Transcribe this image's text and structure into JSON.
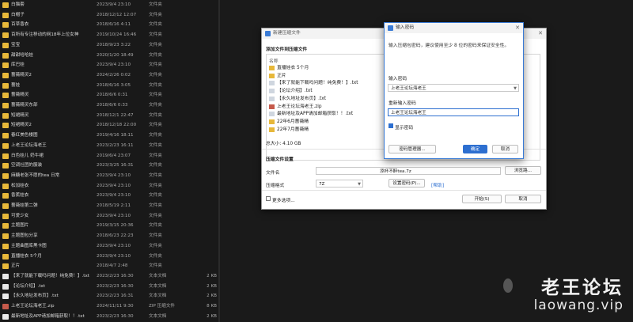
{
  "explorer": {
    "rows": [
      {
        "name": "白猫套",
        "date": "2023/9/4 23:10",
        "type": "文件夹",
        "size": "",
        "icon": "folder-icon"
      },
      {
        "name": "白帽子",
        "date": "2018/12/12 12:07",
        "type": "文件夹",
        "size": "",
        "icon": "folder-icon"
      },
      {
        "name": "百草香衣",
        "date": "2018/6/16 4:11",
        "type": "文件夹",
        "size": "",
        "icon": "folder-icon"
      },
      {
        "name": "百所有专注移动的网18年上位女神",
        "date": "2019/10/24 16:46",
        "type": "文件夹",
        "size": "",
        "icon": "folder-icon"
      },
      {
        "name": "宝宝",
        "date": "2018/9/23 3:22",
        "type": "文件夹",
        "size": "",
        "icon": "folder-icon"
      },
      {
        "name": "甜甜哈哈娃",
        "date": "2020/1/20 18:49",
        "type": "文件夹",
        "size": "",
        "icon": "folder-icon"
      },
      {
        "name": "库巴娃",
        "date": "2023/9/4 23:10",
        "type": "文件夹",
        "size": "",
        "icon": "folder-icon"
      },
      {
        "name": "蔷薇精灵2",
        "date": "2024/2/26 0:02",
        "type": "文件夹",
        "size": "",
        "icon": "folder-icon"
      },
      {
        "name": "蔷娃",
        "date": "2018/6/16 3:05",
        "type": "文件夹",
        "size": "",
        "icon": "folder-icon"
      },
      {
        "name": "蔷薇精灵",
        "date": "2018/6/6 0:31",
        "type": "文件夹",
        "size": "",
        "icon": "folder-icon"
      },
      {
        "name": "蔷薇精灵东部",
        "date": "2018/6/6 0:33",
        "type": "文件夹",
        "size": "",
        "icon": "folder-icon"
      },
      {
        "name": "短裙精灵",
        "date": "2018/12/1 22:47",
        "type": "文件夹",
        "size": "",
        "icon": "folder-icon"
      },
      {
        "name": "短裙精灵2",
        "date": "2018/12/18 22:00",
        "type": "文件夹",
        "size": "",
        "icon": "folder-icon"
      },
      {
        "name": "春红美色楼图",
        "date": "2019/4/16 18:11",
        "type": "文件夹",
        "size": "",
        "icon": "folder-icon"
      },
      {
        "name": "上老王论坛海老王",
        "date": "2023/2/23 16:11",
        "type": "文件夹",
        "size": "",
        "icon": "folder-icon"
      },
      {
        "name": "白色娃儿 奶牛裙",
        "date": "2019/6/4 23:07",
        "type": "文件夹",
        "size": "",
        "icon": "folder-icon"
      },
      {
        "name": "空调社团的服装",
        "date": "2023/3/25 16:31",
        "type": "文件夹",
        "size": "",
        "icon": "folder-icon"
      },
      {
        "name": "麻糖老张不愿的tea 日常",
        "date": "2023/9/4 23:10",
        "type": "文件夹",
        "size": "",
        "icon": "folder-icon"
      },
      {
        "name": "松加娃衣",
        "date": "2023/9/4 23:10",
        "type": "文件夹",
        "size": "",
        "icon": "folder-icon"
      },
      {
        "name": "香蕉娃衣",
        "date": "2023/9/4 23:10",
        "type": "文件夹",
        "size": "",
        "icon": "folder-icon"
      },
      {
        "name": "蔷薇娃第二弹",
        "date": "2018/5/19 2:11",
        "type": "文件夹",
        "size": "",
        "icon": "folder-icon"
      },
      {
        "name": "可爱少女",
        "date": "2023/9/4 23:10",
        "type": "文件夹",
        "size": "",
        "icon": "folder-icon"
      },
      {
        "name": "主题图片",
        "date": "2019/3/15 20:36",
        "type": "文件夹",
        "size": "",
        "icon": "folder-icon"
      },
      {
        "name": "主题图包分享",
        "date": "2018/6/23 22:23",
        "type": "文件夹",
        "size": "",
        "icon": "folder-icon"
      },
      {
        "name": "主题曲图库黑卡图",
        "date": "2023/9/4 23:10",
        "type": "文件夹",
        "size": "",
        "icon": "folder-icon"
      },
      {
        "name": "直播娃衣 5个月",
        "date": "2023/9/4 23:10",
        "type": "文件夹",
        "size": "",
        "icon": "folder-icon"
      },
      {
        "name": "正片",
        "date": "2018/4/7 2:48",
        "type": "文件夹",
        "size": "",
        "icon": "folder-icon"
      },
      {
        "name": "【来了就能下载吗问题！纯免费！】.txt",
        "date": "2023/2/23 16:30",
        "type": "文本文档",
        "size": "2 KB",
        "icon": "text-file-icon"
      },
      {
        "name": "【论坛介绍】.txt",
        "date": "2023/2/23 16:30",
        "type": "文本文档",
        "size": "2 KB",
        "icon": "text-file-icon"
      },
      {
        "name": "【永久地址发布页】.txt",
        "date": "2023/2/23 16:31",
        "type": "文本文档",
        "size": "2 KB",
        "icon": "text-file-icon"
      },
      {
        "name": "上老王论坛海老王.zip",
        "date": "2024/11/11 9:30",
        "type": "ZIP 压缩文件",
        "size": "8 KB",
        "icon": "zip-file-icon"
      },
      {
        "name": "最新地址及APP请加邮箱获取！！.txt",
        "date": "2023/2/23 16:30",
        "type": "文本文档",
        "size": "2 KB",
        "icon": "text-file-icon"
      }
    ]
  },
  "archive_dialog": {
    "title": "新建压缩文件",
    "add_files_label": "添加文件到压缩文件",
    "list_header": "名称",
    "items": [
      {
        "name": "直播娃衣 5个月",
        "icon": "folder-icon"
      },
      {
        "name": "正片",
        "icon": "folder-icon"
      },
      {
        "name": "【来了就能下载吗问题！纯免费！】.txt",
        "icon": "text-file-icon"
      },
      {
        "name": "【论坛介绍】.txt",
        "icon": "text-file-icon"
      },
      {
        "name": "【永久地址发布页】.txt",
        "icon": "text-file-icon"
      },
      {
        "name": "上老王论坛海老王.zip",
        "icon": "zip-file-icon"
      },
      {
        "name": "最新地址及APP请加邮箱获取！！.txt",
        "icon": "text-file-icon"
      },
      {
        "name": "22年6月蔷薇精",
        "icon": "folder-icon"
      },
      {
        "name": "22年7月蔷薇精",
        "icon": "folder-icon"
      }
    ],
    "total_size": "总大小: 4.10 GB",
    "settings_label": "压缩文件设置",
    "filename_label": "文件名",
    "filename_value": "添杯不醉tea.7z",
    "browse_button": "浏览路...",
    "format_label": "压缩格式",
    "format_value": "7Z",
    "set_password_button": "设置密码(P)...",
    "help_link": "[帮助]",
    "more_options_label": "更多选项...",
    "start_button": "开始(S)",
    "cancel_button": "取消"
  },
  "password_dialog": {
    "title": "输入密码",
    "description": "输入压缩包密码，建议使用至少 8 位的密码来保证安全性。",
    "password_label": "输入密码",
    "password_value": "上老王论坛海老王",
    "confirm_label": "重新输入密码",
    "confirm_value": "上老王论坛海老王",
    "show_password_label": "显示密码",
    "manager_button": "密码管理器...",
    "ok_button": "确定",
    "cancel_button": "取消"
  },
  "watermark": {
    "line1": "老王论坛",
    "line2": "laowang.vip"
  }
}
